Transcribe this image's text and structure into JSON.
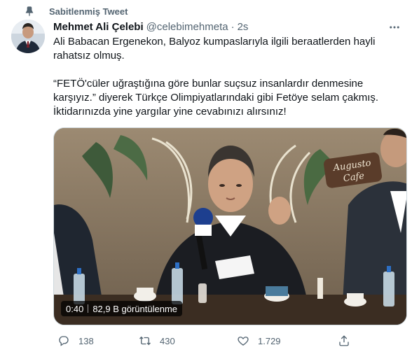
{
  "pinned": {
    "label": "Sabitlenmiş Tweet",
    "icon": "pin-icon"
  },
  "author": {
    "name": "Mehmet Ali Çelebi",
    "handle": "@celebimehmeta",
    "separator": "·",
    "time": "2s",
    "avatar_icon": "avatar"
  },
  "more_icon": "more-icon",
  "tweet": {
    "line1": "Ali Babacan Ergenekon, Balyoz kumpaslarıyla ilgili beraatlerden hayli rahatsız olmuş.",
    "line2": "“FETÖ'cüler uğraştığına göre bunlar suçsuz insanlardır denmesine karşıyız.” diyerek Türkçe Olimpiyatlarındaki gibi Fetöye selam çakmış.",
    "line3": "İktidarınızda yine yargılar yine cevabınızı alırsınız!"
  },
  "media": {
    "duration": "0:40",
    "views": "82,9 B görüntülenme",
    "sign_text_1": "Augusto",
    "sign_text_2": "Cafe"
  },
  "actions": {
    "reply_count": "138",
    "retweet_count": "430",
    "like_count": "1.729",
    "icons": [
      "reply-icon",
      "retweet-icon",
      "like-icon",
      "share-icon"
    ]
  },
  "colors": {
    "text": "#0f1419",
    "secondary": "#536471",
    "border": "#cfd9de"
  }
}
